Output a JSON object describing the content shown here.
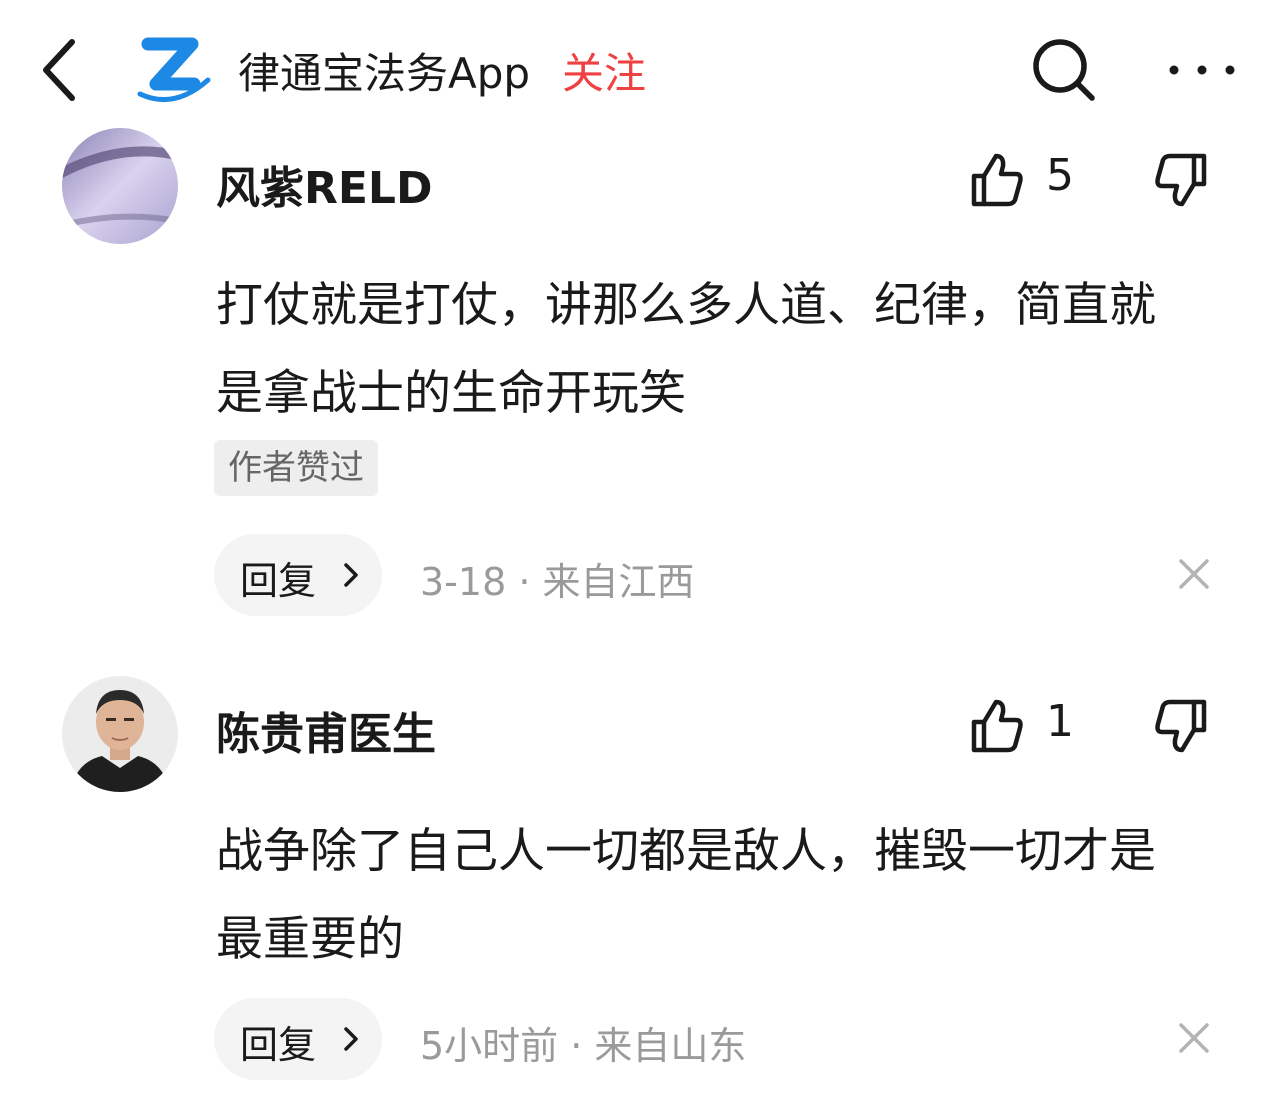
{
  "header": {
    "app_name": "律通宝法务App",
    "follow_label": "关注",
    "colors": {
      "follow": "#f04142",
      "logo_blue": "#1e88e5"
    }
  },
  "comments": [
    {
      "username": "风紫RELD",
      "like_count": "5",
      "content": "打仗就是打仗，讲那么多人道、纪律，简直就是拿战士的生命开玩笑",
      "author_badge": "作者赞过",
      "reply_label": "回复",
      "meta": "3-18 · 来自江西"
    },
    {
      "username": "陈贵甫医生",
      "like_count": "1",
      "content": "战争除了自己人一切都是敌人，摧毁一切才是最重要的",
      "reply_label": "回复",
      "meta": "5小时前 · 来自山东"
    }
  ],
  "icons": [
    "back-arrow-icon",
    "app-logo",
    "search-icon",
    "more-icon",
    "thumbs-up-icon",
    "thumbs-down-icon",
    "chevron-right-icon",
    "close-icon"
  ]
}
